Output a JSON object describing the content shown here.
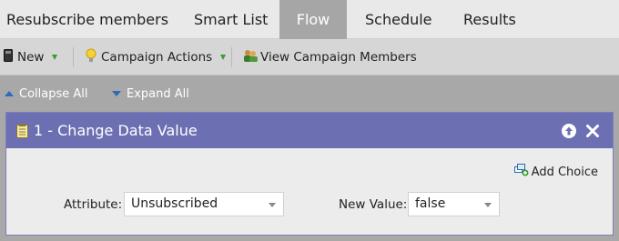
{
  "tabs": [
    {
      "label": "Resubscribe members",
      "active": false
    },
    {
      "label": "Smart List",
      "active": false
    },
    {
      "label": "Flow",
      "active": true
    },
    {
      "label": "Schedule",
      "active": false
    },
    {
      "label": "Results",
      "active": false
    }
  ],
  "toolbar": {
    "new_label": "New",
    "campaign_actions_label": "Campaign Actions",
    "view_members_label": "View Campaign Members"
  },
  "flow_controls": {
    "collapse_all": "Collapse All",
    "expand_all": "Expand All"
  },
  "step": {
    "title": "1 - Change Data Value",
    "add_choice_label": "Add Choice",
    "attribute_label": "Attribute:",
    "attribute_value": "Unsubscribed",
    "new_value_label": "New Value:",
    "new_value_value": "false"
  },
  "colors": {
    "step_header": "#6d6fb3",
    "active_tab": "#a6a6a6",
    "dropdown_arrow": "#3a9a34",
    "flow_arrow": "#2d6bb5"
  }
}
